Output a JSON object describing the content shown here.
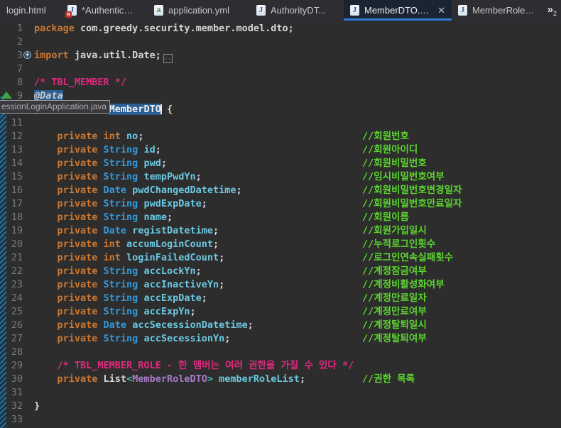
{
  "colors": {
    "editor_bg": "#2D2D2D",
    "tabbar_bg": "#2E2E32",
    "active_tab_bg": "#1B2433",
    "active_tab_underline": "#2D7DD6",
    "keyword": "#CC7832",
    "type": "#3398DB",
    "field": "#6BC8E2",
    "plain": "#D6D6D6",
    "line_comment": "#5CD52E",
    "block_comment": "#E1297F",
    "class_ref": "#A87BC8",
    "generic_bracket": "#3EBFB3",
    "selection_bg": "#2B5F94",
    "line_number": "#7A7A7A",
    "marker_green": "#43A04C"
  },
  "tab_bar": {
    "tabs": [
      {
        "label": "login.html",
        "icon": "none",
        "active": false,
        "width": 84,
        "gap": 0
      },
      {
        "label": "*Authentica...",
        "icon": "java-error",
        "active": false,
        "width": 114,
        "gap": 2
      },
      {
        "label": "application.yml",
        "icon": "yml",
        "active": false,
        "width": 134,
        "gap": 8
      },
      {
        "label": "AuthorityDT...",
        "icon": "java",
        "active": false,
        "width": 126,
        "gap": 10
      },
      {
        "label": "MemberDTO.java",
        "icon": "java",
        "active": true,
        "width": 152,
        "gap": 6,
        "closable": true
      },
      {
        "label": "MemberRoleD...",
        "icon": "java",
        "active": false,
        "width": 126,
        "gap": 0
      }
    ],
    "overflow": {
      "symbol": "»",
      "count": "2"
    }
  },
  "editor": {
    "tooltip": {
      "text": "essionLoginApplication.java"
    },
    "lines": [
      {
        "num": "1",
        "tokens": [
          {
            "t": "kw",
            "s": "package"
          },
          {
            "t": "pl",
            "s": " com.greedy.security.member.model.dto;"
          }
        ]
      },
      {
        "num": "2",
        "tokens": []
      },
      {
        "num": "3",
        "fold": true,
        "collapsed_box": "..",
        "tokens": [
          {
            "t": "kw",
            "s": "import"
          },
          {
            "t": "pl",
            "s": " java.util.Date;"
          }
        ]
      },
      {
        "num": "7",
        "tokens": []
      },
      {
        "num": "8",
        "tokens": [
          {
            "t": "bc",
            "s": "/* TBL_MEMBER */"
          }
        ]
      },
      {
        "num": "9",
        "marker": "green-triangle",
        "tokens": [
          {
            "t": "ann",
            "s": "@Data"
          }
        ]
      },
      {
        "num": "10",
        "tokens": [
          {
            "t": "kw",
            "s": "public class "
          },
          {
            "t": "selword",
            "s": "MemberDTO"
          },
          {
            "t": "pl",
            "s": " {"
          }
        ]
      },
      {
        "num": "11",
        "tokens": []
      },
      {
        "num": "12",
        "tokens": [
          {
            "t": "kw",
            "s": "    private int "
          },
          {
            "t": "fld",
            "s": "no"
          },
          {
            "t": "pl",
            "s": ";"
          }
        ],
        "comment": "//회원번호"
      },
      {
        "num": "13",
        "tokens": [
          {
            "t": "kw",
            "s": "    private "
          },
          {
            "t": "ty",
            "s": "String "
          },
          {
            "t": "fld",
            "s": "id"
          },
          {
            "t": "pl",
            "s": ";"
          }
        ],
        "comment": "//회원아이디"
      },
      {
        "num": "14",
        "tokens": [
          {
            "t": "kw",
            "s": "    private "
          },
          {
            "t": "ty",
            "s": "String "
          },
          {
            "t": "fld",
            "s": "pwd"
          },
          {
            "t": "pl",
            "s": ";"
          }
        ],
        "comment": "//회원비밀번호"
      },
      {
        "num": "15",
        "tokens": [
          {
            "t": "kw",
            "s": "    private "
          },
          {
            "t": "ty",
            "s": "String "
          },
          {
            "t": "fld",
            "s": "tempPwdYn"
          },
          {
            "t": "pl",
            "s": ";"
          }
        ],
        "comment": "//임시비밀번호여부"
      },
      {
        "num": "16",
        "tokens": [
          {
            "t": "kw",
            "s": "    private "
          },
          {
            "t": "ty",
            "s": "Date "
          },
          {
            "t": "fld",
            "s": "pwdChangedDatetime"
          },
          {
            "t": "pl",
            "s": ";"
          }
        ],
        "comment": "//회원비밀번호변경일자"
      },
      {
        "num": "17",
        "tokens": [
          {
            "t": "kw",
            "s": "    private "
          },
          {
            "t": "ty",
            "s": "String "
          },
          {
            "t": "fld",
            "s": "pwdExpDate"
          },
          {
            "t": "pl",
            "s": ";"
          }
        ],
        "comment": "//회원비밀번호만료일자"
      },
      {
        "num": "18",
        "tokens": [
          {
            "t": "kw",
            "s": "    private "
          },
          {
            "t": "ty",
            "s": "String "
          },
          {
            "t": "fld",
            "s": "name"
          },
          {
            "t": "pl",
            "s": ";"
          }
        ],
        "comment": "//회원이름"
      },
      {
        "num": "19",
        "tokens": [
          {
            "t": "kw",
            "s": "    private "
          },
          {
            "t": "ty",
            "s": "Date "
          },
          {
            "t": "fld",
            "s": "registDatetime"
          },
          {
            "t": "pl",
            "s": ";"
          }
        ],
        "comment": "//회원가입일시"
      },
      {
        "num": "20",
        "tokens": [
          {
            "t": "kw",
            "s": "    private int "
          },
          {
            "t": "fld",
            "s": "accumLoginCount"
          },
          {
            "t": "pl",
            "s": ";"
          }
        ],
        "comment": "//누적로그인횟수"
      },
      {
        "num": "21",
        "tokens": [
          {
            "t": "kw",
            "s": "    private int "
          },
          {
            "t": "fld",
            "s": "loginFailedCount"
          },
          {
            "t": "pl",
            "s": ";"
          }
        ],
        "comment": "//로그인연속실패횟수"
      },
      {
        "num": "22",
        "tokens": [
          {
            "t": "kw",
            "s": "    private "
          },
          {
            "t": "ty",
            "s": "String "
          },
          {
            "t": "fld",
            "s": "accLockYn"
          },
          {
            "t": "pl",
            "s": ";"
          }
        ],
        "comment": "//계정잠금여부"
      },
      {
        "num": "23",
        "tokens": [
          {
            "t": "kw",
            "s": "    private "
          },
          {
            "t": "ty",
            "s": "String "
          },
          {
            "t": "fld",
            "s": "accInactiveYn"
          },
          {
            "t": "pl",
            "s": ";"
          }
        ],
        "comment": "//계정비활성화여부"
      },
      {
        "num": "24",
        "tokens": [
          {
            "t": "kw",
            "s": "    private "
          },
          {
            "t": "ty",
            "s": "String "
          },
          {
            "t": "fld",
            "s": "accExpDate"
          },
          {
            "t": "pl",
            "s": ";"
          }
        ],
        "comment": "//계정만료일자"
      },
      {
        "num": "25",
        "tokens": [
          {
            "t": "kw",
            "s": "    private "
          },
          {
            "t": "ty",
            "s": "String "
          },
          {
            "t": "fld",
            "s": "accExpYn"
          },
          {
            "t": "pl",
            "s": ";"
          }
        ],
        "comment": "//계정만료여부"
      },
      {
        "num": "26",
        "tokens": [
          {
            "t": "kw",
            "s": "    private "
          },
          {
            "t": "ty",
            "s": "Date "
          },
          {
            "t": "fld",
            "s": "accSecessionDatetime"
          },
          {
            "t": "pl",
            "s": ";"
          }
        ],
        "comment": "//계정탈퇴일시"
      },
      {
        "num": "27",
        "tokens": [
          {
            "t": "kw",
            "s": "    private "
          },
          {
            "t": "ty",
            "s": "String "
          },
          {
            "t": "fld",
            "s": "accSecessionYn"
          },
          {
            "t": "pl",
            "s": ";"
          }
        ],
        "comment": "//계정탈퇴여부"
      },
      {
        "num": "28",
        "tokens": []
      },
      {
        "num": "29",
        "tokens": [
          {
            "t": "bc",
            "s": "    /* TBL_MEMBER_ROLE - 한 멤버는 여러 권한을 가질 수 있다 */"
          }
        ]
      },
      {
        "num": "30",
        "tokens": [
          {
            "t": "kw",
            "s": "    private "
          },
          {
            "t": "pl",
            "s": "List"
          },
          {
            "t": "gen",
            "s": "<"
          },
          {
            "t": "pur",
            "s": "MemberRoleDTO"
          },
          {
            "t": "gen",
            "s": ">"
          },
          {
            "t": "fld",
            "s": " memberRoleList"
          },
          {
            "t": "pl",
            "s": ";"
          }
        ],
        "comment": "//권한 목록"
      },
      {
        "num": "31",
        "tokens": []
      },
      {
        "num": "32",
        "tokens": [
          {
            "t": "pl",
            "s": "}"
          }
        ]
      },
      {
        "num": "33",
        "tokens": []
      }
    ]
  }
}
